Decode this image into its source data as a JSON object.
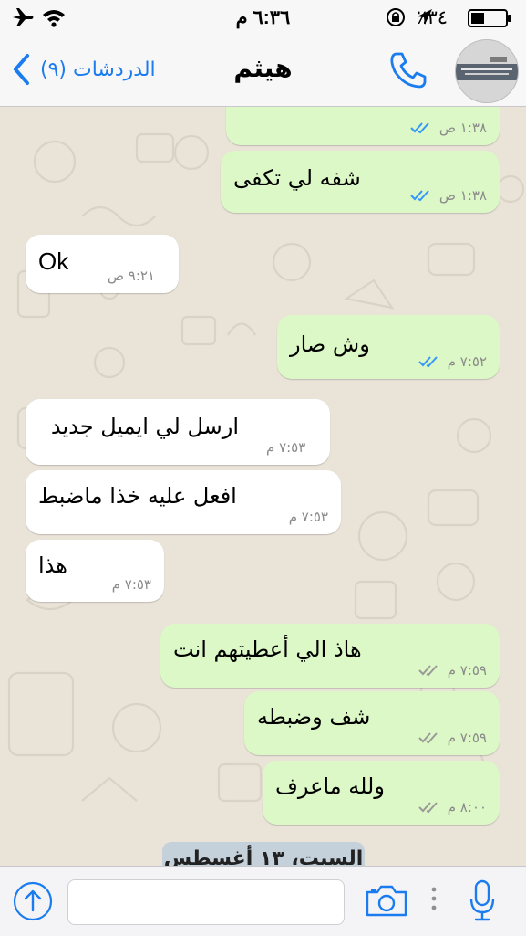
{
  "status_bar": {
    "time": "٦:٣٦ م",
    "battery_percent": "٪٣٤",
    "icons": [
      "airplane-icon",
      "wifi-icon",
      "rotation-lock-icon",
      "location-icon",
      "battery-icon"
    ]
  },
  "nav": {
    "back_label": "الدردشات (٩)",
    "title": "هيثم",
    "icons": [
      "chevron-left-icon",
      "phone-icon",
      "contact-avatar"
    ]
  },
  "messages": [
    {
      "side": "out",
      "text": "",
      "time": "١:٣٨ ص",
      "status": "read"
    },
    {
      "side": "out",
      "text": "شفه لي تكفى",
      "time": "١:٣٨ ص",
      "status": "read"
    },
    {
      "side": "in",
      "text": "Ok",
      "time": "٩:٢١ ص"
    },
    {
      "side": "out",
      "text": "وش صار",
      "time": "٧:٥٢ م",
      "status": "read"
    },
    {
      "side": "in",
      "text": "ارسل لي ايميل جديد",
      "time": "٧:٥٣ م"
    },
    {
      "side": "in",
      "text": "افعل عليه خذا ماضبط",
      "time": "٧:٥٣ م"
    },
    {
      "side": "in",
      "text": "هذا",
      "time": "٧:٥٣ م"
    },
    {
      "side": "out",
      "text": "هاذ الي أعطيتهم انت",
      "time": "٧:٥٩ م",
      "status": "delivered"
    },
    {
      "side": "out",
      "text": "شف وضبطه",
      "time": "٧:٥٩ م",
      "status": "delivered"
    },
    {
      "side": "out",
      "text": "ولله ماعرف",
      "time": "٨:٠٠ م",
      "status": "delivered"
    }
  ],
  "date_divider": "السبت، ١٣ أغسطس",
  "input_bar": {
    "message_value": "",
    "icons": [
      "upload-icon",
      "camera-icon",
      "more-dots-icon",
      "microphone-icon"
    ]
  },
  "colors": {
    "accent": "#1b7cf0",
    "outgoing_bubble": "#dcf8c6",
    "incoming_bubble": "#ffffff",
    "read_ticks": "#3497f9",
    "delivered_ticks": "#9a9a9a",
    "chat_background": "#e9e3d8"
  }
}
